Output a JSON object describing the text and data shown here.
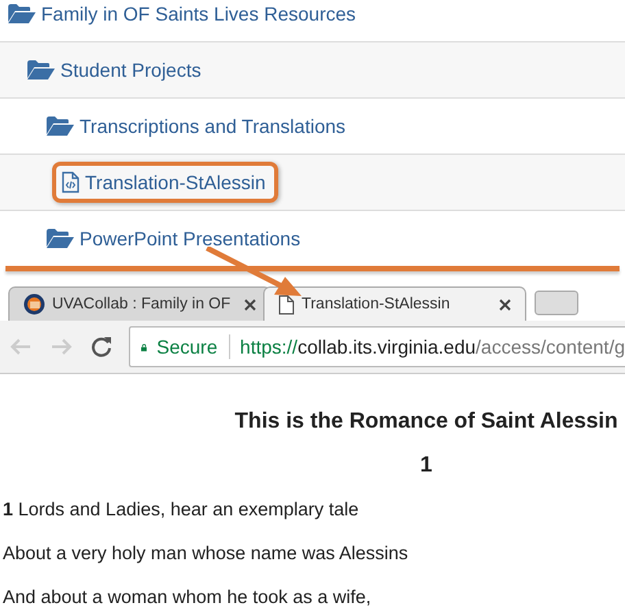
{
  "tree": [
    {
      "label": "Family in OF Saints Lives Resources",
      "kind": "folder",
      "highlighted": false,
      "children": [
        {
          "label": "Student Projects",
          "kind": "folder",
          "highlighted": false,
          "children": [
            {
              "label": "Transcriptions and Translations",
              "kind": "folder",
              "highlighted": false,
              "children": [
                {
                  "label": "Translation-StAlessin",
                  "kind": "file",
                  "highlighted": true
                }
              ]
            },
            {
              "label": "PowerPoint Presentations",
              "kind": "folder",
              "highlighted": false
            }
          ]
        }
      ]
    }
  ],
  "browser": {
    "tabs": [
      {
        "title": "UVACollab : Family in OF",
        "kind": "site",
        "selected": false
      },
      {
        "title": "Translation-StAlessin",
        "kind": "file",
        "selected": true
      }
    ],
    "security": "Secure",
    "url_scheme": "https://",
    "url_host": "collab.its.virginia.edu",
    "url_path": "/access/content/g"
  },
  "document": {
    "title": "This is the Romance of Saint Alessin",
    "section": "1",
    "lines": [
      "**1** Lords and Ladies, hear an exemplary tale",
      "About a very holy man whose name was Alessins",
      "And about a woman whom he took as a wife,"
    ]
  }
}
